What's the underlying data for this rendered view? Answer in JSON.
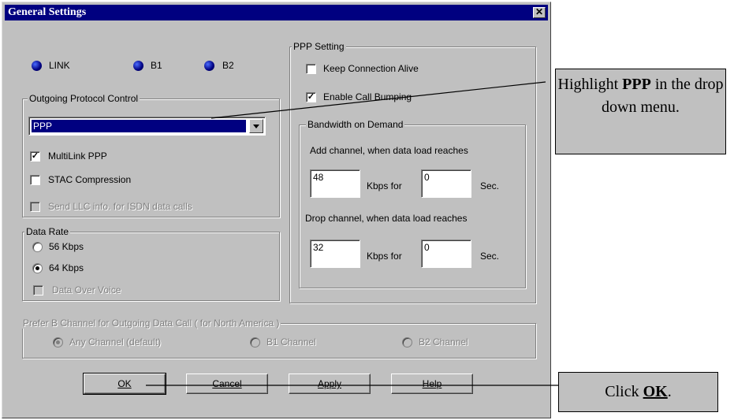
{
  "dialog": {
    "title": "General Settings",
    "close_glyph": "✕"
  },
  "leds": [
    {
      "label": "LINK"
    },
    {
      "label": "B1"
    },
    {
      "label": "B2"
    }
  ],
  "outgoing": {
    "group_title": "Outgoing Protocol Control",
    "protocol_selected": "PPP",
    "multilink_label": "MultiLink PPP",
    "multilink_checked": true,
    "stac_label": "STAC Compression",
    "stac_checked": false,
    "llc_label": "Send LLC info. for ISDN data calls",
    "llc_checked": false
  },
  "data_rate": {
    "group_title": "Data Rate",
    "opt_56": "56 Kbps",
    "opt_64": "64 Kbps",
    "selected": "64 Kbps",
    "dov_label": "Data Over Voice"
  },
  "ppp": {
    "group_title": "PPP Setting",
    "keep_alive_label": "Keep Connection Alive",
    "keep_alive_checked": false,
    "bumping_label": "Enable Call Bumping",
    "bumping_checked": true,
    "bod": {
      "group_title": "Bandwidth on Demand",
      "add_text": "Add channel, when data load reaches",
      "add_kbps": "48",
      "add_sec": "0",
      "drop_text": "Drop channel, when data load reaches",
      "drop_kbps": "32",
      "drop_sec": "0",
      "kbps_for": "Kbps for",
      "sec": "Sec."
    }
  },
  "prefer": {
    "group_title": "Prefer B Channel for Outgoing Data Call ( for North America )",
    "any": "Any Channel (default)",
    "b1": "B1 Channel",
    "b2": "B2 Channel",
    "selected": "Any Channel (default)"
  },
  "buttons": {
    "ok": "OK",
    "cancel": "Cancel",
    "apply": "Apply",
    "help": "Help"
  },
  "callouts": {
    "ppp_prefix": "Highlight ",
    "ppp_bold": "PPP",
    "ppp_suffix": " in the drop down menu.",
    "ok_prefix": "Click ",
    "ok_bold": "OK",
    "ok_suffix": "."
  },
  "colors": {
    "dialog_bg": "#c0c0c0",
    "titlebar": "#000080",
    "selection": "#000080",
    "led": "#000080"
  }
}
